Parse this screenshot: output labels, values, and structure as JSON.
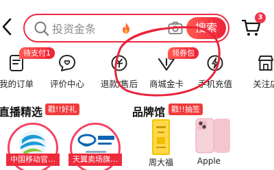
{
  "header": {
    "back_icon": "back-arrow-icon",
    "search": {
      "placeholder": "投资金条",
      "trending_icon": "flame-icon",
      "camera_icon": "camera-icon",
      "button_label": "搜索"
    },
    "cart": {
      "icon": "cart-icon",
      "badge_count": "3"
    }
  },
  "shortcuts": [
    {
      "label": "我的订单",
      "icon": "order-icon",
      "badge": "待支付1"
    },
    {
      "label": "评价中心",
      "icon": "review-icon",
      "badge": ""
    },
    {
      "label": "退款/售后",
      "icon": "refund-icon",
      "badge": ""
    },
    {
      "label": "商城金卡",
      "icon": "gold-card-icon",
      "badge": "领券包"
    },
    {
      "label": "手机充值",
      "icon": "phone-topup-icon",
      "badge": ""
    },
    {
      "label": "关注店",
      "icon": "followed-store-icon",
      "badge": ""
    }
  ],
  "live": {
    "title": "直播精选",
    "badge": "戳!!好礼",
    "cards": [
      {
        "caption": "中国移动官…"
      },
      {
        "caption": "天翼卖场旗…"
      }
    ]
  },
  "brands": {
    "title": "品牌馆",
    "badge": "戳!!抽签",
    "items": [
      {
        "name": "周大福"
      },
      {
        "name": "Apple"
      }
    ]
  },
  "colors": {
    "accent": "#ef2a40",
    "annotation": "#e8243a"
  }
}
